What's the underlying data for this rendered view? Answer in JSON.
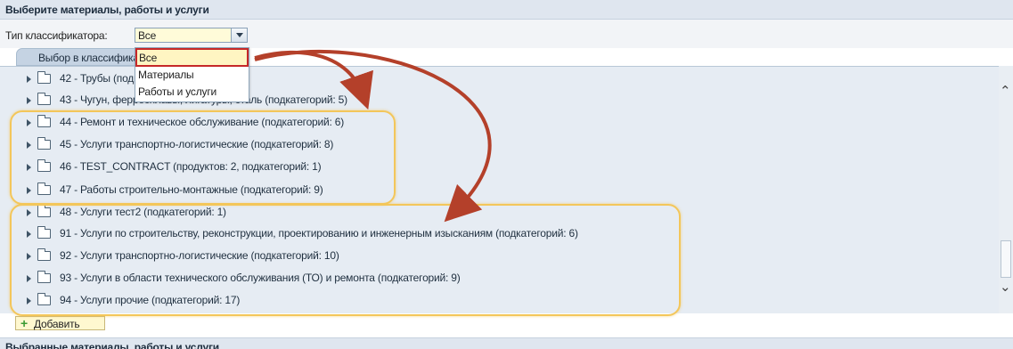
{
  "header": {
    "title": "Выберите материалы, работы и услуги"
  },
  "type_selector": {
    "label": "Тип классификатора:",
    "value": "Все"
  },
  "tab": {
    "label": "Выбор в классификаторе"
  },
  "dropdown": {
    "options": [
      "Все",
      "Материалы",
      "Работы и услуги"
    ],
    "selected": "Все"
  },
  "tree": {
    "items": [
      {
        "label": "42 - Трубы (подкатегорий: 4)"
      },
      {
        "label": "43 - Чугун, ферросплавы, лигатуры, сталь (подкатегорий: 5)"
      },
      {
        "label": "44 - Ремонт и техническое обслуживание (подкатегорий: 6)"
      },
      {
        "label": "45 - Услуги транспортно-логистические (подкатегорий: 8)"
      },
      {
        "label": "46 - TEST_CONTRACT (продуктов: 2, подкатегорий: 1)"
      },
      {
        "label": "47 - Работы строительно-монтажные (подкатегорий: 9)"
      },
      {
        "label": "48 - Услуги тест2 (подкатегорий: 1)"
      },
      {
        "label": "91 - Услуги по строительству, реконструкции, проектированию и инженерным изысканиям (подкатегорий: 6)"
      },
      {
        "label": "92 - Услуги транспортно-логистические (подкатегорий: 10)"
      },
      {
        "label": "93 - Услуги в области технического обслуживания (ТО) и ремонта (подкатегорий: 9)"
      },
      {
        "label": "94 - Услуги прочие (подкатегорий: 17)"
      }
    ]
  },
  "add_button": {
    "label": "Добавить"
  },
  "bottom_section": {
    "title": "Выбранные материалы, работы и услуги"
  },
  "colors": {
    "highlight": "#f3c65a",
    "arrow": "#b4402a",
    "selection_border": "#c62828"
  },
  "icons": {
    "expand": "triangle-right-icon",
    "folder": "folder-icon",
    "add": "plus-icon",
    "scroll_up": "chevron-up-icon",
    "scroll_down": "chevron-down-icon"
  }
}
